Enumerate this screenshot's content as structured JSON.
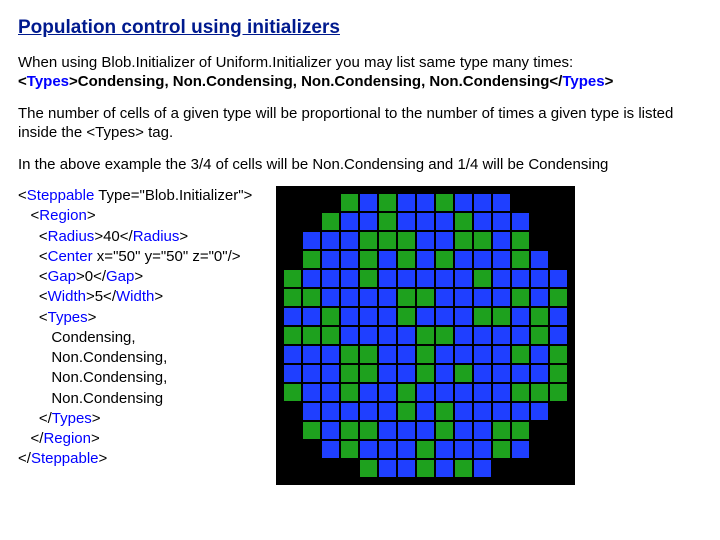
{
  "title": "Population control using initializers",
  "para1_plain": "When using Blob.Initializer of Uniform.Initializer you may list same type many times:",
  "types_line": {
    "open_tag": "Types",
    "content": "Condensing, Non.Condensing, Non.Condensing, Non.Condensing",
    "close_tag": "Types"
  },
  "para2": "The number of cells of a given type will be proportional to the number of times a given type is listed inside the <Types> tag.",
  "para3": "In the above example the 3/4 of cells will be Non.Condensing and 1/4 will be Condensing",
  "code": {
    "l01a": "<",
    "l01b": "Steppable",
    "l01c": " Type=\"Blob.Initializer\">",
    "l02a": "   <",
    "l02b": "Region",
    "l02c": ">",
    "l03a": "     <",
    "l03b": "Radius",
    "l03c": ">40</",
    "l03d": "Radius",
    "l03e": ">",
    "l04a": "     <",
    "l04b": "Center",
    "l04c": " x=\"50\" y=\"50\" z=\"0\"/>",
    "l05a": "     <",
    "l05b": "Gap",
    "l05c": ">0</",
    "l05d": "Gap",
    "l05e": ">",
    "l06a": "     <",
    "l06b": "Width",
    "l06c": ">5</",
    "l06d": "Width",
    "l06e": ">",
    "l07a": "     <",
    "l07b": "Types",
    "l07c": ">",
    "l08": "        Condensing,",
    "l09": "        Non.Condensing,",
    "l10": "        Non.Condensing,",
    "l11": "        Non.Condensing",
    "l12a": "     </",
    "l12b": "Types",
    "l12c": ">",
    "l13a": "   </",
    "l13b": "Region",
    "l13c": ">",
    "l14a": "</",
    "l14b": "Steppable",
    "l14c": ">"
  },
  "sim": {
    "cols": 15,
    "cellSize": 17,
    "rows": [
      "...GBGBBGBBB....",
      "..GBBGBBBGBBB..",
      ".BBBGGGBBGGBG..",
      ".GBBGBGBGBBBGB.",
      "GBBBGBBBBBGBBBB",
      "GGBBBBGGBBBBGBG",
      "BBGBBBGBBBGGBGB",
      "GGGBBBBGGBBBBGB",
      "BBBGGBBGBBBBGBG",
      "BBBGGBBGBGBBBBG",
      "GBBGBBGBBBBBGGG",
      ".BBBBBGBGBBBBB.",
      ".GBGGBBBGBBGG..",
      "..BGBBBGBBBGB..",
      "....GBBGBGB...."
    ]
  }
}
